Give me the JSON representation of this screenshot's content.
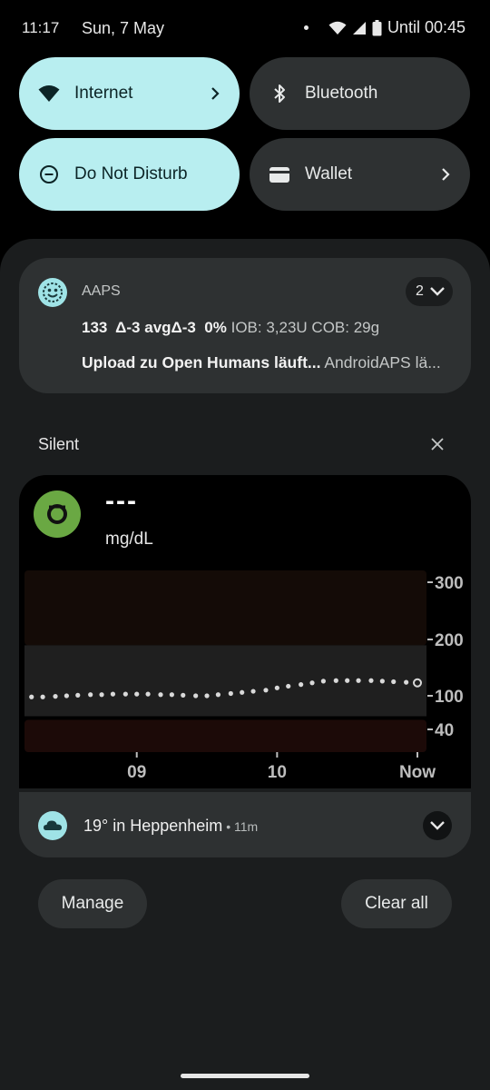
{
  "status_bar": {
    "time": "11:17",
    "date": "Sun, 7 May",
    "battery_text": "Until 00:45"
  },
  "quick_settings": {
    "tiles": [
      {
        "label": "Internet",
        "icon": "wifi-icon",
        "active": true,
        "has_chevron": true
      },
      {
        "label": "Bluetooth",
        "icon": "bluetooth-icon",
        "active": false,
        "has_chevron": false
      },
      {
        "label": "Do Not Disturb",
        "icon": "do-not-disturb-icon",
        "active": true,
        "has_chevron": false
      },
      {
        "label": "Wallet",
        "icon": "wallet-icon",
        "active": false,
        "has_chevron": true
      }
    ]
  },
  "notification_aaps": {
    "app_name": "AAPS",
    "count": "2",
    "line1_bold": "133  Δ-3 avgΔ-3  0%",
    "line1_detail": " IOB: 3,23U COB: 29g",
    "line2_bold": "Upload zu Open Humans läuft...",
    "line2_detail": " AndroidAPS lä..."
  },
  "silent_section": {
    "label": "Silent"
  },
  "notification_xdrip": {
    "value": "---",
    "unit": "mg/dL"
  },
  "chart_data": {
    "type": "scatter",
    "y_ticks": [
      "300",
      "200",
      "100",
      "40"
    ],
    "x_ticks": [
      "09",
      "10",
      "Now"
    ],
    "ylim": [
      40,
      300
    ],
    "target_range": [
      70,
      180
    ],
    "x": [
      -2.75,
      -2.67,
      -2.58,
      -2.5,
      -2.42,
      -2.33,
      -2.25,
      -2.17,
      -2.08,
      -2.0,
      -1.92,
      -1.83,
      -1.75,
      -1.67,
      -1.58,
      -1.5,
      -1.42,
      -1.33,
      -1.25,
      -1.17,
      -1.08,
      -1.0,
      -0.92,
      -0.83,
      -0.75,
      -0.67,
      -0.58,
      -0.5,
      -0.42,
      -0.33,
      -0.25,
      -0.17,
      -0.08,
      0.0
    ],
    "y": [
      98,
      98,
      99,
      100,
      101,
      102,
      102,
      103,
      103,
      103,
      103,
      102,
      102,
      101,
      100,
      100,
      102,
      104,
      106,
      108,
      110,
      114,
      117,
      120,
      123,
      126,
      127,
      127,
      127,
      127,
      126,
      125,
      124,
      123
    ],
    "colors": {
      "points": "#d9d9d9",
      "target_band": "#1f1f1f",
      "high_zone": "#140b07",
      "low_zone": "#1c0a08"
    }
  },
  "notification_weather": {
    "title": "19° in Heppenheim",
    "age": " • 11m"
  },
  "actions": {
    "manage_label": "Manage",
    "clear_all_label": "Clear all"
  },
  "colors": {
    "tile_active": "#b8eef0",
    "tile_inactive": "#2e3132",
    "shade_background": "#1b1d1e",
    "xdrip_logo": "#6aa843"
  }
}
